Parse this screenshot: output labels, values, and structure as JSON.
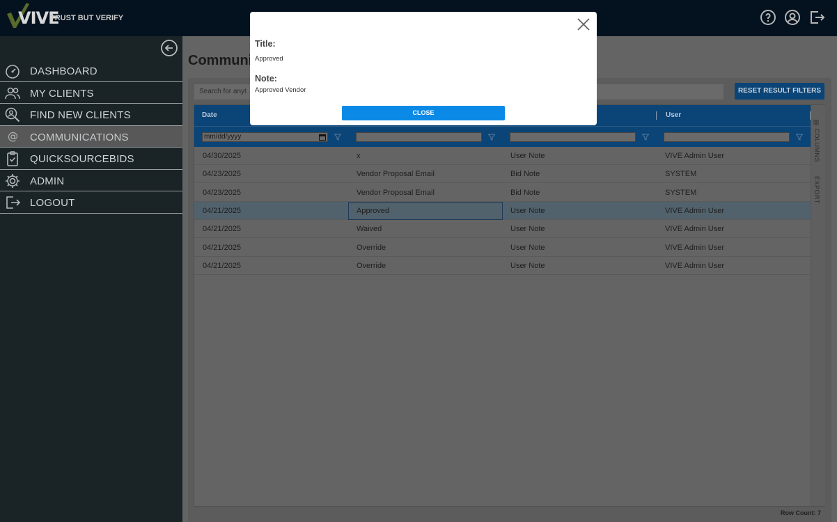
{
  "header": {
    "logo_text": "VIVE",
    "tagline": "TRUST BUT VERIFY",
    "icons": [
      "help-icon",
      "account-icon",
      "logout-icon"
    ]
  },
  "sidebar": {
    "collapse_icon": "arrow-left-circle-icon",
    "items": [
      {
        "label": "DASHBOARD",
        "icon": "speedometer-icon",
        "active": false
      },
      {
        "label": "MY CLIENTS",
        "icon": "users-icon",
        "active": false
      },
      {
        "label": "FIND NEW CLIENTS",
        "icon": "search-user-icon",
        "active": false
      },
      {
        "label": "COMMUNICATIONS",
        "icon": "at-sign-icon",
        "active": true
      },
      {
        "label": "QUICKSOURCEBIDS",
        "icon": "clipboard-check-icon",
        "active": false
      },
      {
        "label": "ADMIN",
        "icon": "gear-icon",
        "active": false
      },
      {
        "label": "LOGOUT",
        "icon": "logout-icon",
        "active": false
      }
    ]
  },
  "main": {
    "page_title": "Communic",
    "search_placeholder": "Search for anyt",
    "reset_button": "RESET RESULT FILTERS",
    "columns": [
      {
        "label": "Date"
      },
      {
        "label": ""
      },
      {
        "label": ""
      },
      {
        "label": "User"
      }
    ],
    "date_filter_placeholder": "mm/dd/yyyy",
    "side_tools": [
      "COLUMNS",
      "EXPORT"
    ],
    "rows": [
      {
        "date": "04/30/2025",
        "title": "x",
        "type": "User Note",
        "user": "VIVE Admin User"
      },
      {
        "date": "04/23/2025",
        "title": "Vendor Proposal Email",
        "type": "Bid Note",
        "user": "SYSTEM"
      },
      {
        "date": "04/23/2025",
        "title": "Vendor Proposal Email",
        "type": "Bid Note",
        "user": "SYSTEM"
      },
      {
        "date": "04/21/2025",
        "title": "Approved",
        "type": "User Note",
        "user": "VIVE Admin User"
      },
      {
        "date": "04/21/2025",
        "title": "Waived",
        "type": "User Note",
        "user": "VIVE Admin User"
      },
      {
        "date": "04/21/2025",
        "title": "Override",
        "type": "User Note",
        "user": "VIVE Admin User"
      },
      {
        "date": "04/21/2025",
        "title": "Override",
        "type": "User Note",
        "user": "VIVE Admin User"
      }
    ],
    "row_count": "Row Count: 7"
  },
  "modal": {
    "title_label": "Title:",
    "title_value": "Approved",
    "note_label": "Note:",
    "note_value": "Approved Vendor",
    "close_button": "CLOSE"
  },
  "colors": {
    "header_bg": "#061727",
    "sidebar_bg": "#1a2326",
    "grid_header": "#0b4477",
    "close_button": "#0a8ae6"
  }
}
